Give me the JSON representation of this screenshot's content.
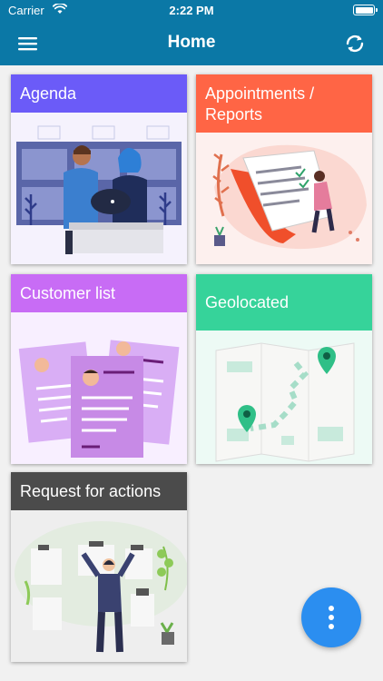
{
  "status_bar": {
    "carrier": "Carrier",
    "time": "2:22 PM"
  },
  "app_bar": {
    "title": "Home",
    "menu_icon": "hamburger-menu-icon",
    "refresh_icon": "refresh-icon"
  },
  "tiles": {
    "agenda": {
      "label": "Agenda",
      "color": "#6b5bf8"
    },
    "appointments": {
      "label": "Appointments / Reports",
      "color": "#ff6545"
    },
    "customers": {
      "label": "Customer list",
      "color": "#c86cf5"
    },
    "geolocated": {
      "label": "Geolocated",
      "color": "#36d39a"
    },
    "requests": {
      "label": "Request for actions",
      "color": "#4b4b4b"
    }
  },
  "fab": {
    "icon": "more-vertical-icon",
    "color": "#2b8ef0"
  },
  "colors": {
    "primary": "#0b78a6",
    "background": "#f1f1f1"
  }
}
